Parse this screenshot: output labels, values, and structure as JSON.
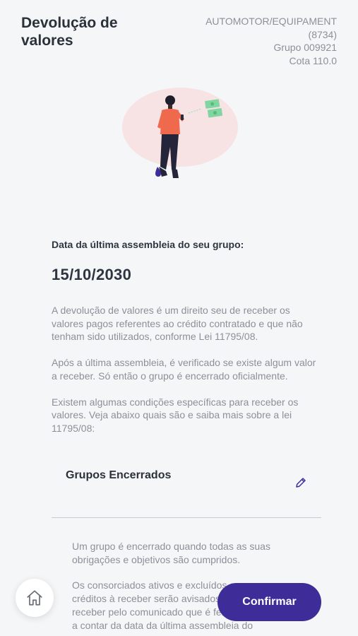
{
  "header": {
    "title": "Devolução de valores",
    "group_info": [
      "AUTOMOTOR/EQUIPAMENT",
      "(8734)",
      "Grupo 009921",
      "Cota 110.0"
    ]
  },
  "main": {
    "last_assembly_label": "Data da última assembleia do seu grupo:",
    "last_assembly_date": "15/10/2030",
    "paragraphs": [
      "A devolução de valores é um direito seu de receber os valores pagos referentes ao crédito contratado e que não tenham sido utilizados, conforme Lei 11795/08.",
      "Após a última assembleia, é verificado se existe algum valor a receber. Só então o grupo é encerrado oficialmente.",
      "Existem algumas condições específicas para receber os valores. Veja abaixo quais são e saiba mais sobre a lei 11795/08:"
    ]
  },
  "accordion": {
    "title": "Grupos Encerrados",
    "icon": "pencil-icon",
    "body": [
      "Um grupo é encerrado quando todas as suas obrigações e objetivos são cumpridos.",
      "Os consorciados ativos e excluídos que possuem créditos à receber serão avisados sobre os valores a receber pelo comunicado que é feito em até 60 dias, a contar da data da última assembleia do"
    ]
  },
  "footer": {
    "home_icon": "home-icon",
    "confirm_label": "Confirmar"
  },
  "colors": {
    "primary": "#3e2c98",
    "text_dark": "#2d3540",
    "text_muted": "#8b9098",
    "background": "#f5f6f8"
  }
}
